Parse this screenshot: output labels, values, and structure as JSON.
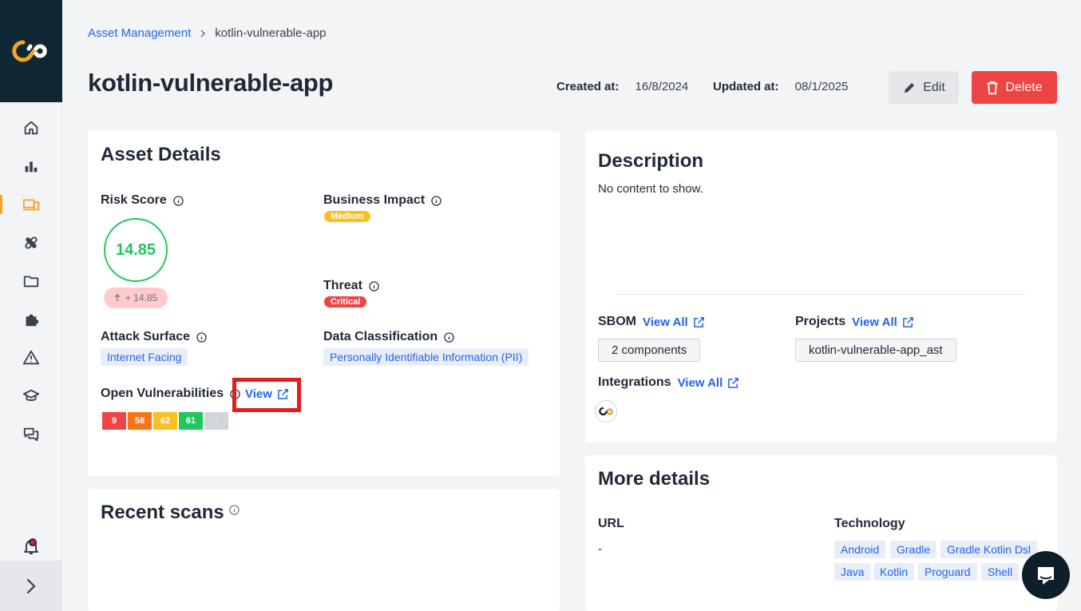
{
  "breadcrumb": {
    "parent": "Asset Management",
    "separator": ">",
    "current": "kotlin-vulnerable-app"
  },
  "page": {
    "title": "kotlin-vulnerable-app"
  },
  "meta": {
    "created_label": "Created at:",
    "created_value": "16/8/2024",
    "updated_label": "Updated at:",
    "updated_value": "08/1/2025"
  },
  "actions": {
    "edit": "Edit",
    "delete": "Delete"
  },
  "asset_details": {
    "title": "Asset Details",
    "risk_score_label": "Risk Score",
    "risk_score_value": "14.85",
    "risk_delta": "+ 14.85",
    "business_impact_label": "Business Impact",
    "business_impact_value": "Medium",
    "threat_label": "Threat",
    "threat_value": "Critical",
    "attack_surface_label": "Attack Surface",
    "attack_surface_value": "Internet Facing",
    "data_classification_label": "Data Classification",
    "data_classification_value": "Personally Identifiable Information (PII)",
    "open_vulns_label": "Open Vulnerabilities",
    "open_vulns_view": "View",
    "vulns": [
      {
        "count": "9",
        "color": "#ef4444"
      },
      {
        "count": "58",
        "color": "#f97316"
      },
      {
        "count": "62",
        "color": "#fbbf24"
      },
      {
        "count": "61",
        "color": "#22c55e"
      },
      {
        "count": "-",
        "color": "#d1d5db"
      }
    ]
  },
  "recent_scans": {
    "title": "Recent scans"
  },
  "description": {
    "title": "Description",
    "body": "No content to show.",
    "sbom_label": "SBOM",
    "sbom_link": "View All",
    "sbom_value": "2 components",
    "projects_label": "Projects",
    "projects_link": "View All",
    "projects_value": "kotlin-vulnerable-app_ast",
    "integrations_label": "Integrations",
    "integrations_link": "View All"
  },
  "more_details": {
    "title": "More details",
    "url_label": "URL",
    "url_value": "-",
    "technology_label": "Technology",
    "technologies": [
      "Android",
      "Gradle",
      "Gradle Kotlin Dsl",
      "Java",
      "Kotlin",
      "Proguard",
      "Shell"
    ]
  },
  "colors": {
    "brand_dark": "#0f2733",
    "accent": "#f5a524",
    "link": "#2563eb",
    "danger": "#ef4444",
    "success": "#22c55e"
  }
}
